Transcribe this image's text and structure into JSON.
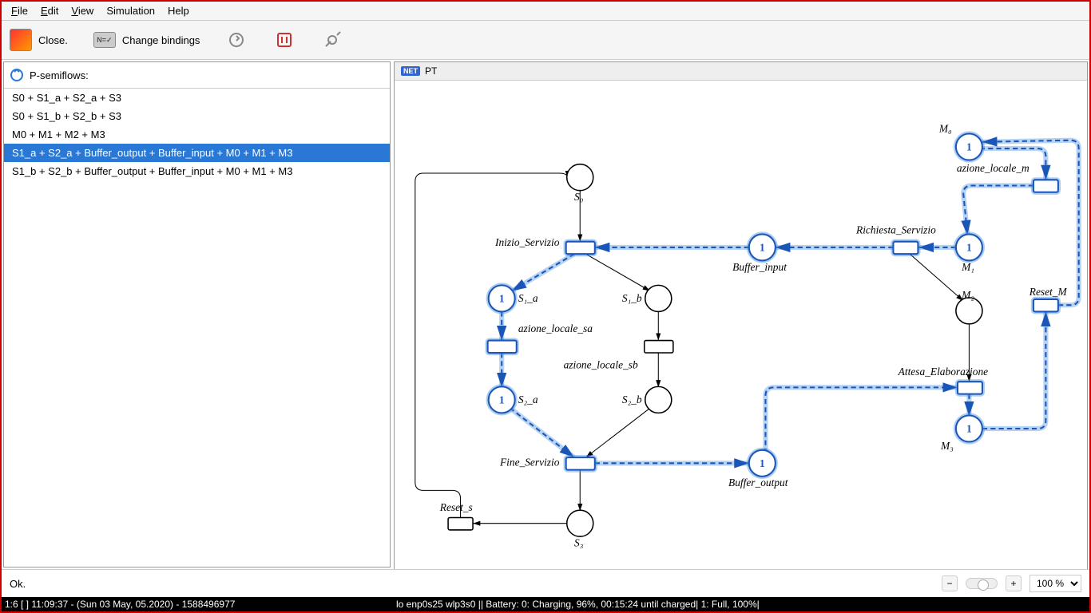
{
  "menubar": {
    "file": "File",
    "edit": "Edit",
    "view": "View",
    "simulation": "Simulation",
    "help": "Help"
  },
  "toolbar": {
    "close": "Close.",
    "bindings": "Change bindings",
    "bindings_badge": "N=✓"
  },
  "left": {
    "title": "P-semiflows:",
    "items": [
      "S0 + S1_a + S2_a + S3",
      "S0 + S1_b + S2_b + S3",
      "M0 + M1 + M2 + M3",
      "S1_a + S2_a + Buffer_output + Buffer_input + M0 + M1 + M3",
      "S1_b + S2_b + Buffer_output + Buffer_input + M0 + M1 + M3"
    ],
    "selected_index": 3
  },
  "net": {
    "tab": "PT",
    "badge": "NET"
  },
  "diagram": {
    "places": {
      "S0": {
        "label": "S₀"
      },
      "S1a": {
        "label": "S₁_a",
        "token": "1",
        "hl": true
      },
      "S1b": {
        "label": "S₁_b"
      },
      "S2a": {
        "label": "S₂_a",
        "token": "1",
        "hl": true
      },
      "S2b": {
        "label": "S₂_b"
      },
      "S3": {
        "label": "S₃"
      },
      "Bi": {
        "label": "Buffer_input",
        "token": "1",
        "hl": true
      },
      "Bo": {
        "label": "Buffer_output",
        "token": "1",
        "hl": true
      },
      "M0": {
        "label": "M₀",
        "token": "1",
        "hl": true
      },
      "M1": {
        "label": "M₁",
        "token": "1",
        "hl": true
      },
      "M2": {
        "label": "M₂"
      },
      "M3": {
        "label": "M₃",
        "token": "1",
        "hl": true
      }
    },
    "transitions": {
      "Inizio": {
        "label": "Inizio_Servizio",
        "hl": true
      },
      "az_sa": {
        "label": "azione_locale_sa",
        "hl": true
      },
      "az_sb": {
        "label": "azione_locale_sb"
      },
      "Fine": {
        "label": "Fine_Servizio",
        "hl": true
      },
      "Reset_s": {
        "label": "Reset_s"
      },
      "az_m": {
        "label": "azione_locale_m",
        "hl": true
      },
      "Richiesta": {
        "label": "Richiesta_Servizio",
        "hl": true
      },
      "Attesa": {
        "label": "Attesa_Elaborazione",
        "hl": true
      },
      "Reset_M": {
        "label": "Reset_M",
        "hl": true
      }
    }
  },
  "status": {
    "ok": "Ok."
  },
  "zoom": {
    "value": "100 %"
  },
  "os_status": {
    "left": "1:6 [ ]    11:09:37 - (Sun 03 May, 05.2020) - 1588496977",
    "right": "lo enp0s25 wlp3s0   ||   Battery: 0: Charging, 96%, 00:15:24 until charged| 1: Full, 100%|"
  }
}
